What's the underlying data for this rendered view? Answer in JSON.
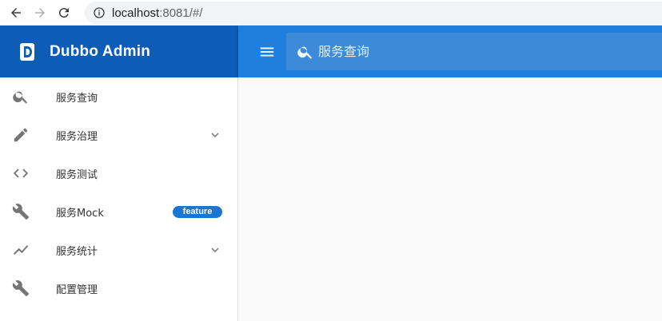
{
  "browser": {
    "url_host": "localhost",
    "url_path": ":8081/#/"
  },
  "header": {
    "brand_title": "Dubbo Admin",
    "search_placeholder": "服务查询"
  },
  "sidebar": {
    "items": [
      {
        "label": "服务查询",
        "icon": "search-icon"
      },
      {
        "label": "服务治理",
        "icon": "pencil-icon",
        "expandable": true
      },
      {
        "label": "服务测试",
        "icon": "code-icon"
      },
      {
        "label": "服务Mock",
        "icon": "wrench-icon",
        "badge": "feature"
      },
      {
        "label": "服务统计",
        "icon": "trending-icon",
        "expandable": true
      },
      {
        "label": "配置管理",
        "icon": "wrench-icon"
      }
    ]
  },
  "colors": {
    "brand": "#0d5cb6",
    "toolbar": "#1e7fde",
    "search_box": "#3c8ad8",
    "badge": "#1976d2"
  }
}
